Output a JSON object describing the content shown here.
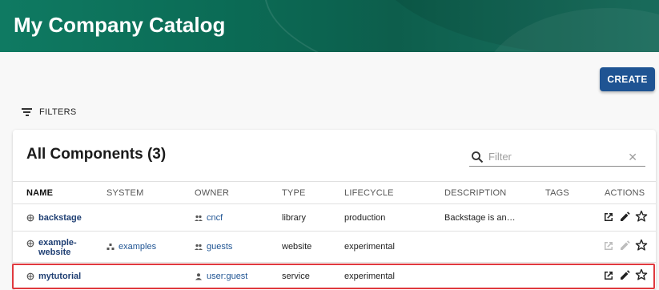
{
  "header": {
    "title": "My Company Catalog"
  },
  "toolbar": {
    "create_label": "CREATE",
    "filters_label": "FILTERS"
  },
  "card": {
    "title": "All Components (3)"
  },
  "search": {
    "placeholder": "Filter",
    "clear_symbol": "✕"
  },
  "table": {
    "columns": [
      "NAME",
      "SYSTEM",
      "OWNER",
      "TYPE",
      "LIFECYCLE",
      "DESCRIPTION",
      "TAGS",
      "ACTIONS"
    ],
    "rows": [
      {
        "name": "backstage",
        "system": "",
        "owner": "cncf",
        "type": "library",
        "lifecycle": "production",
        "description": "Backstage is an…",
        "tags": "",
        "actions_enabled": true
      },
      {
        "name": "example-website",
        "system": "examples",
        "owner": "guests",
        "type": "website",
        "lifecycle": "experimental",
        "description": "",
        "tags": "",
        "actions_enabled": false
      },
      {
        "name": "mytutorial",
        "system": "",
        "owner": "user:guest",
        "type": "service",
        "lifecycle": "experimental",
        "description": "",
        "tags": "",
        "actions_enabled": true
      }
    ]
  },
  "colors": {
    "header_green": "#0b6b55",
    "primary_blue": "#1f5493",
    "highlight_red": "#e0393e"
  },
  "icons": {
    "component": "component-icon",
    "system": "system-icon",
    "group": "group-icon",
    "user": "user-icon",
    "open": "open-in-new-icon",
    "edit": "edit-icon",
    "star": "star-outline-icon"
  }
}
